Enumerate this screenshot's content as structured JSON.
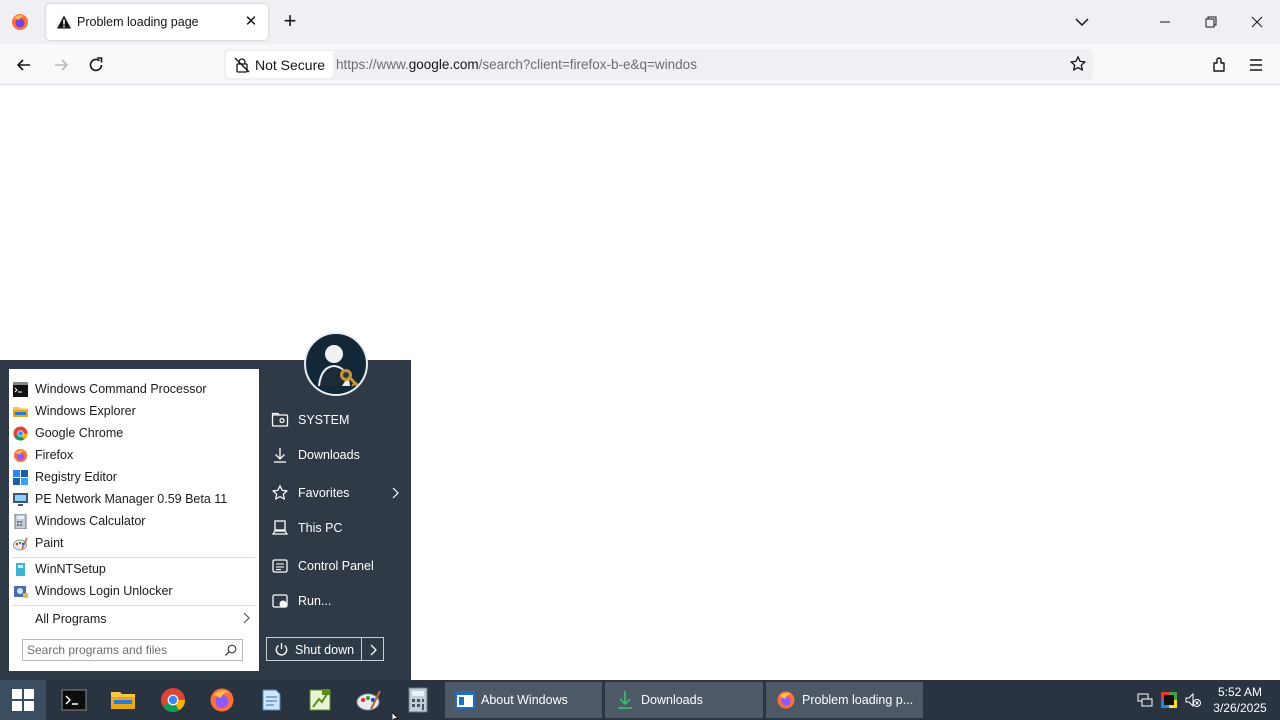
{
  "browser": {
    "tab": {
      "title": "Problem loading page"
    },
    "navbar": {
      "security_label": "Not Secure",
      "url_prefix": "https://www.",
      "url_host": "google.com",
      "url_suffix": "/search?client=firefox-b-e&q=windos"
    }
  },
  "start_menu": {
    "programs": [
      {
        "label": "Windows Command Processor",
        "icon": "cmd-icon"
      },
      {
        "label": "Windows Explorer",
        "icon": "folder-icon"
      },
      {
        "label": "Google Chrome",
        "icon": "chrome-icon"
      },
      {
        "label": "Firefox",
        "icon": "firefox-icon"
      },
      {
        "label": "Registry Editor",
        "icon": "registry-icon"
      },
      {
        "label": "PE Network Manager 0.59 Beta 11",
        "icon": "network-icon"
      },
      {
        "label": "Windows Calculator",
        "icon": "calculator-icon"
      },
      {
        "label": "Paint",
        "icon": "paint-icon"
      },
      {
        "label": "WinNTSetup",
        "icon": "setup-icon"
      },
      {
        "label": "Windows Login Unlocker",
        "icon": "unlocker-icon"
      }
    ],
    "all_programs_label": "All Programs",
    "search_placeholder": "Search programs and files",
    "places": [
      {
        "label": "SYSTEM",
        "icon": "user-folder-icon"
      },
      {
        "label": "Downloads",
        "icon": "download-icon"
      },
      {
        "label": "Favorites",
        "icon": "star-icon"
      },
      {
        "label": "This PC",
        "icon": "computer-icon"
      },
      {
        "label": "Control Panel",
        "icon": "control-panel-icon"
      },
      {
        "label": "Run...",
        "icon": "run-icon"
      }
    ],
    "shutdown_label": "Shut down"
  },
  "taskbar": {
    "tasks": [
      {
        "label": "About Windows",
        "icon": "window-icon"
      },
      {
        "label": "Downloads",
        "icon": "download-icon"
      },
      {
        "label": "Problem loading p...",
        "icon": "firefox-icon"
      }
    ],
    "clock": {
      "time": "5:52 AM",
      "date": "3/26/2025"
    }
  }
}
